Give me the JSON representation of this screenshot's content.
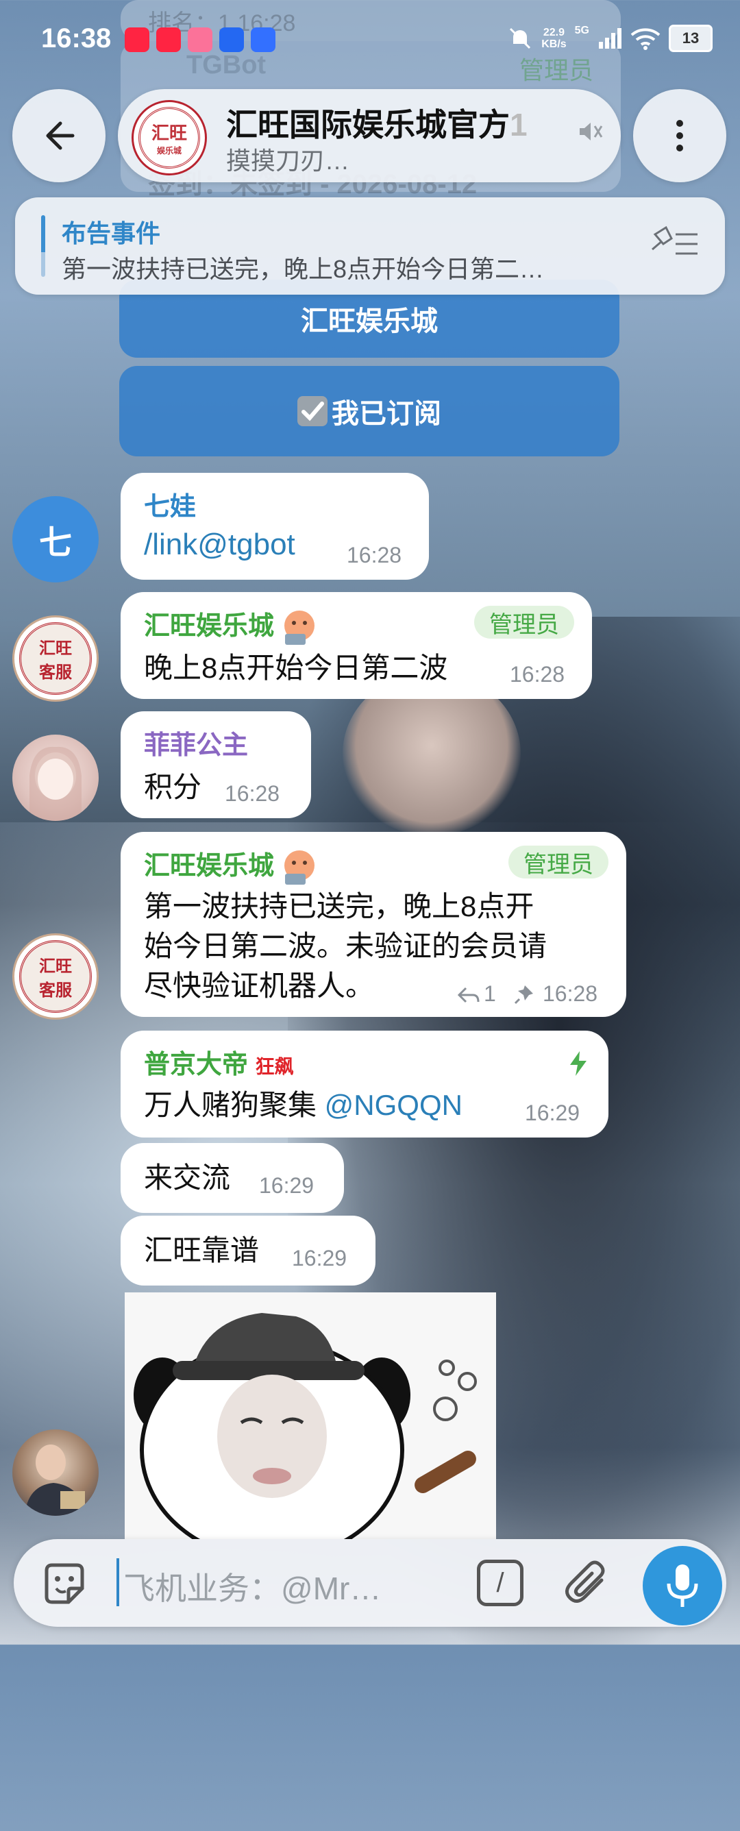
{
  "status_bar": {
    "time": "16:38",
    "app_icons": [
      "小红书",
      "小红书",
      "bilibili",
      "百度贴吧",
      "飞书"
    ],
    "net_speed_value": "22.9",
    "net_speed_unit": "KB/s",
    "network": "5G",
    "battery": "13"
  },
  "header": {
    "title": "汇旺国际娱乐城官方",
    "title_overflow": "1",
    "subtitle": "摸摸刀刃…",
    "avatar_text_top": "汇旺",
    "avatar_text_bottom": "娱乐城"
  },
  "pinned": {
    "title": "布告事件",
    "text": "第一波扶持已送完，晚上8点开始今日第二…"
  },
  "behind_text": {
    "bot_name": "TGBot",
    "role": "管理员",
    "faded_line": "签到：未签到 - 2026-08-12",
    "faded_top": "排名：1 16:28"
  },
  "inline_buttons": [
    "汇旺娱乐城",
    "我已订阅"
  ],
  "messages": [
    {
      "sender": "七娃",
      "avatar_text": "七",
      "sender_color": "#2f86c8",
      "text": "/link@tgbot",
      "time": "16:28"
    },
    {
      "sender": "汇旺娱乐城",
      "badge": "管理员",
      "sender_color": "#3fa63f",
      "text": "晚上8点开始今日第二波",
      "time": "16:28",
      "avatar_top": "汇旺",
      "avatar_bottom": "客服"
    },
    {
      "sender": "菲菲公主",
      "sender_color": "#8a67c2",
      "text": "积分",
      "time": "16:28"
    },
    {
      "sender": "汇旺娱乐城",
      "badge": "管理员",
      "sender_color": "#3fa63f",
      "lines": [
        "第一波扶持已送完，晚上8点开",
        "始今日第二波。未验证的会员请",
        "尽快验证机器人。"
      ],
      "reply_count": "1",
      "time": "16:28",
      "avatar_top": "汇旺",
      "avatar_bottom": "客服"
    },
    {
      "sender": "普京大帝",
      "sender_tag": "狂飙",
      "sender_color": "#3fa63f",
      "text": "万人赌狗聚集 ",
      "mention": "@NGQQN",
      "time": "16:29"
    },
    {
      "text": "来交流",
      "time": "16:29"
    },
    {
      "text": "汇旺靠谱",
      "time": "16:29"
    }
  ],
  "input": {
    "placeholder": "飞机业务：@Mr…",
    "command_icon": "/"
  },
  "icons": [
    "back-arrow-icon",
    "more-vertical-icon",
    "mute-icon",
    "pin-list-icon",
    "sticker-icon",
    "command-icon",
    "attach-icon",
    "mic-icon",
    "forward-icon",
    "pin-icon",
    "lightning-icon"
  ]
}
